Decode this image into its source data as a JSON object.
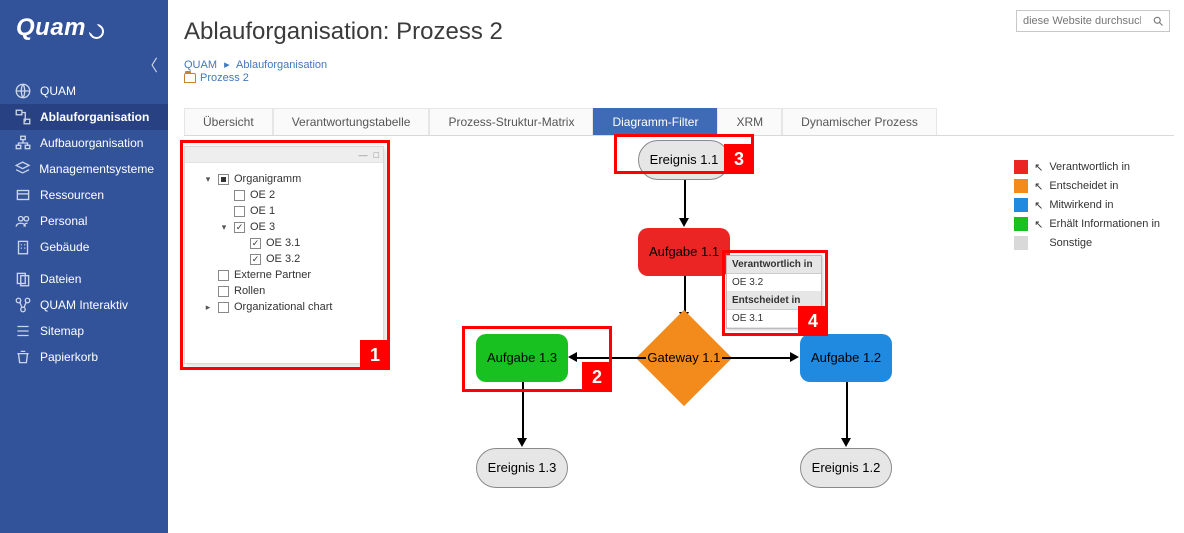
{
  "brand": "Quam",
  "search": {
    "placeholder": "diese Website durchsuchen"
  },
  "sidebar": {
    "items": [
      {
        "label": "QUAM"
      },
      {
        "label": "Ablauforganisation"
      },
      {
        "label": "Aufbauorganisation"
      },
      {
        "label": "Managementsysteme"
      },
      {
        "label": "Ressourcen"
      },
      {
        "label": "Personal"
      },
      {
        "label": "Gebäude"
      },
      {
        "label": "Dateien"
      },
      {
        "label": "QUAM Interaktiv"
      },
      {
        "label": "Sitemap"
      },
      {
        "label": "Papierkorb"
      }
    ]
  },
  "page": {
    "title": "Ablauforganisation: Prozess 2"
  },
  "breadcrumb": {
    "a": "QUAM",
    "b": "Ablauforganisation",
    "c": "Prozess 2"
  },
  "tabs": [
    {
      "label": "Übersicht"
    },
    {
      "label": "Verantwortungstabelle"
    },
    {
      "label": "Prozess-Struktur-Matrix"
    },
    {
      "label": "Diagramm-Filter"
    },
    {
      "label": "XRM"
    },
    {
      "label": "Dynamischer Prozess"
    }
  ],
  "filter_tree": {
    "organigramm": "Organigramm",
    "oe2": "OE 2",
    "oe1": "OE 1",
    "oe3": "OE 3",
    "oe31": "OE 3.1",
    "oe32": "OE 3.2",
    "externe": "Externe Partner",
    "rollen": "Rollen",
    "orgchart": "Organizational chart"
  },
  "diagram": {
    "ereignis11": "Ereignis 1.1",
    "aufgabe11": "Aufgabe 1.1",
    "gateway11": "Gateway 1.1",
    "aufgabe12": "Aufgabe 1.2",
    "aufgabe13": "Aufgabe 1.3",
    "ereignis12": "Ereignis 1.2",
    "ereignis13": "Ereignis 1.3"
  },
  "popup": {
    "h1": "Verantwortlich in",
    "v1": "OE 3.2",
    "h2": "Entscheidet in",
    "v2": "OE 3.1"
  },
  "legend": {
    "l1": "Verantwortlich in",
    "l2": "Entscheidet in",
    "l3": "Mitwirkend in",
    "l4": "Erhält Informationen in",
    "l5": "Sonstige"
  },
  "colors": {
    "red": "#eb2424",
    "orange": "#f28a1c",
    "blue": "#1f8ae0",
    "green": "#18c120",
    "grey": "#d9d9d9"
  },
  "annotations": {
    "n1": "1",
    "n2": "2",
    "n3": "3",
    "n4": "4"
  }
}
